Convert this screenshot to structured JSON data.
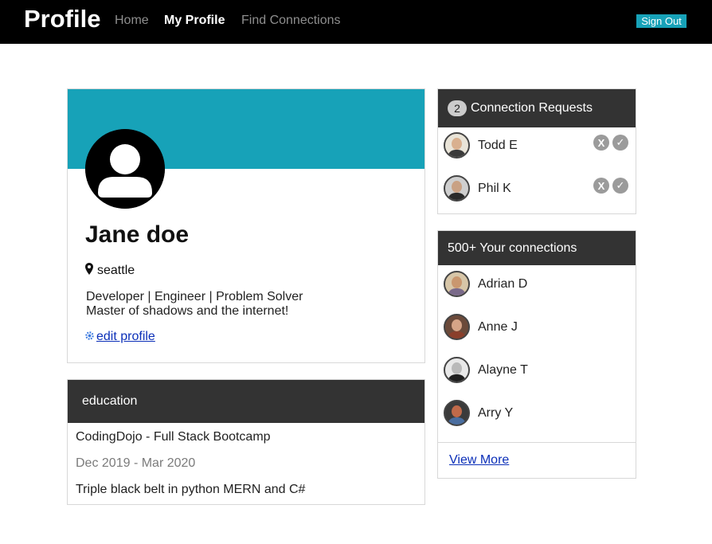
{
  "nav": {
    "brand": "Profile",
    "links": [
      "Home",
      "My Profile",
      "Find Connections"
    ],
    "active": "My Profile",
    "sign_out": "Sign Out"
  },
  "profile": {
    "name": "Jane doe",
    "location_icon": "map-marker-icon",
    "location": "seattle",
    "bio_line1": "Developer | Engineer | Problem Solver",
    "bio_line2": "Master of shadows and the internet!",
    "edit_icon": "gear-icon",
    "edit_label": " edit profile"
  },
  "education": {
    "title": "education",
    "school": "CodingDojo - Full Stack Bootcamp",
    "dates": "Dec 2019 - Mar 2020",
    "description": "Triple black belt in python MERN and C#"
  },
  "requests": {
    "count": "2",
    "title": "Connection Requests",
    "items": [
      {
        "name": "Todd E",
        "reject": "X",
        "accept": "✓"
      },
      {
        "name": "Phil K",
        "reject": "X",
        "accept": "✓"
      }
    ]
  },
  "connections": {
    "title": "500+ Your connections",
    "items": [
      {
        "name": "Adrian D"
      },
      {
        "name": "Anne J"
      },
      {
        "name": "Alayne T"
      },
      {
        "name": "Arry Y"
      }
    ],
    "view_more": "View More"
  },
  "colors": {
    "nav_bg": "#000000",
    "accent": "#17a2b8",
    "card_header": "#333333",
    "link": "#0b2fb8"
  }
}
